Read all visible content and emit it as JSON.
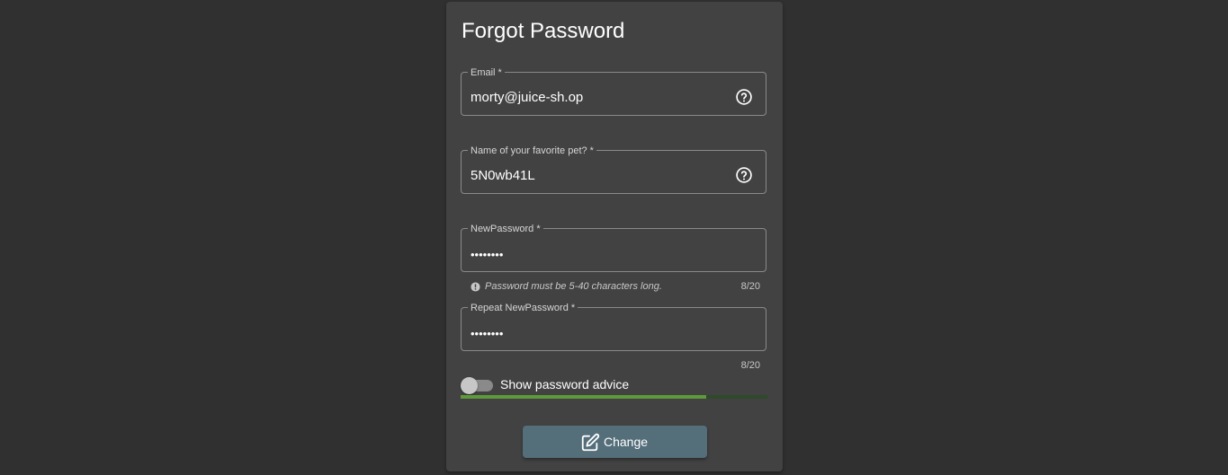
{
  "colors": {
    "background": "#303030",
    "card": "#424242",
    "button": "#546e7a",
    "strength_fill": "#5d9a3b"
  },
  "form": {
    "title": "Forgot Password",
    "email": {
      "label": "Email *",
      "value": "morty@juice-sh.op",
      "icon": "help-circle-icon"
    },
    "security_answer": {
      "label": "Name of your favorite pet? *",
      "value": "5N0wb41L",
      "icon": "help-circle-icon"
    },
    "new_password": {
      "label": "NewPassword *",
      "value": "••••••••",
      "hint": "Password must be 5-40 characters long.",
      "counter": "8/20"
    },
    "repeat_password": {
      "label": "Repeat NewPassword *",
      "value": "••••••••",
      "counter": "8/20"
    },
    "advice_toggle": {
      "label": "Show password advice",
      "checked": false
    },
    "strength": {
      "percent": 80
    },
    "change_button": {
      "label": "Change",
      "icon": "edit-icon"
    }
  }
}
